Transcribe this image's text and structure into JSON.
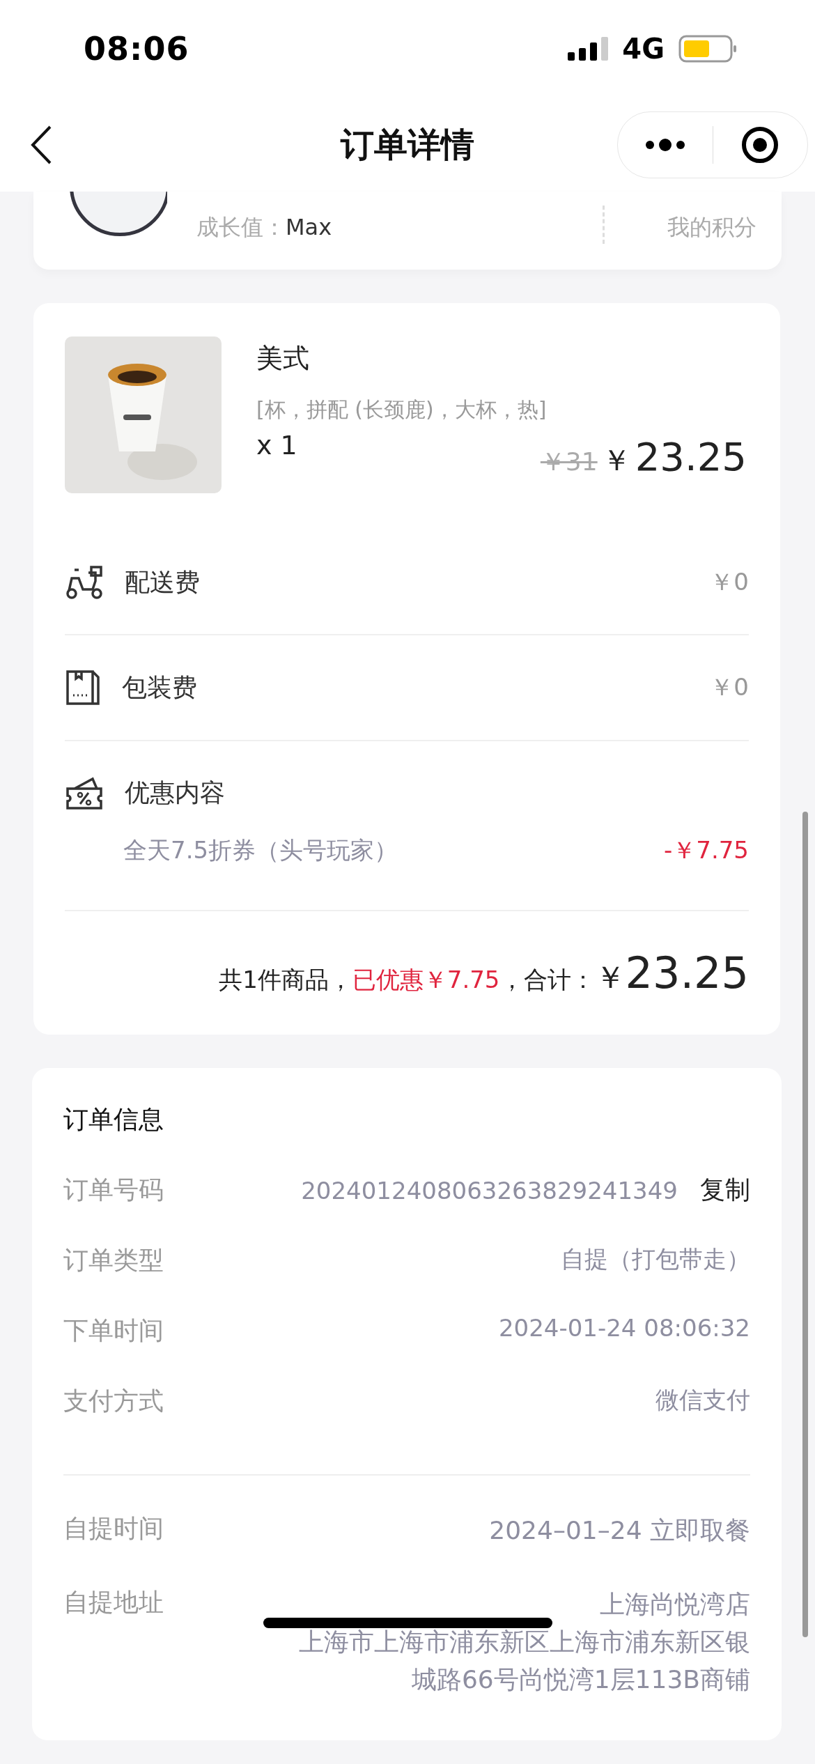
{
  "status_bar": {
    "time": "08:06",
    "network": "4G"
  },
  "nav": {
    "title": "订单详情"
  },
  "member_card": {
    "growth_label": "成长值：",
    "growth_value": "Max",
    "points_label": "我的积分"
  },
  "order_item": {
    "name": "美式",
    "spec": "[杯，拼配 (长颈鹿)，大杯，热]",
    "quantity": "x 1",
    "original_price": "￥31",
    "price_symbol": "￥",
    "price": "23.25"
  },
  "fees": [
    {
      "kind": "delivery",
      "label": "配送费",
      "amount": "￥0"
    },
    {
      "kind": "packaging",
      "label": "包装费",
      "amount": "￥0"
    },
    {
      "kind": "discount",
      "label": "优惠内容",
      "items": [
        {
          "name": "全天7.5折券（头号玩家）",
          "amount": "-￥7.75"
        }
      ]
    }
  ],
  "summary": {
    "count": "共1件商品，",
    "discount": "已优惠￥7.75",
    "total_label": "，合计：",
    "symbol": "￥",
    "total": "23.25"
  },
  "order_info": {
    "title": "订单信息",
    "rows": [
      {
        "label": "订单号码",
        "value": "2024012408063263829241349",
        "action": "复制"
      },
      {
        "label": "订单类型",
        "value": "自提（打包带走）"
      },
      {
        "label": "下单时间",
        "value": "2024-01-24 08:06:32"
      },
      {
        "label": "支付方式",
        "value": "微信支付"
      }
    ],
    "pickup_rows": [
      {
        "label": "自提时间",
        "lines": [
          "2024–01–24 立即取餐"
        ]
      },
      {
        "label": "自提地址",
        "lines": [
          "上海尚悦湾店",
          "上海市上海市浦东新区上海市浦东新区银",
          "城路66号尚悦湾1层113B商铺"
        ]
      }
    ]
  }
}
